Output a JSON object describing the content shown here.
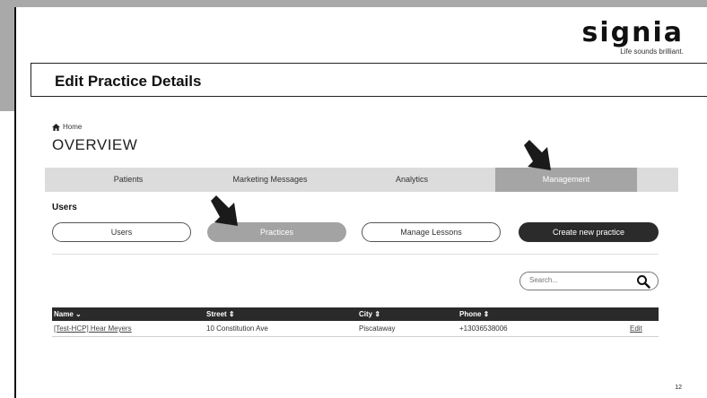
{
  "logo": {
    "wordmark": "signia",
    "tagline": "Life sounds brilliant."
  },
  "slide": {
    "title": "Edit Practice Details",
    "page_number": "12"
  },
  "breadcrumb": {
    "home_label": "Home"
  },
  "page": {
    "heading": "OVERVIEW"
  },
  "nav": {
    "tabs": [
      {
        "label": "Patients"
      },
      {
        "label": "Marketing Messages"
      },
      {
        "label": "Analytics"
      },
      {
        "label": "Management",
        "active": true
      }
    ]
  },
  "users_section": {
    "label": "Users",
    "buttons": {
      "users": "Users",
      "practices": "Practices",
      "manage_lessons": "Manage Lessons",
      "create_practice": "Create new practice"
    }
  },
  "search": {
    "placeholder": "Search..."
  },
  "table": {
    "headers": [
      "Name ⌄",
      "Street ⇕",
      "City ⇕",
      "Phone ⇕",
      ""
    ],
    "rows": [
      {
        "name": "[Test-HCP] Hear Meyers",
        "street": "10 Constitution Ave",
        "city": "Piscataway",
        "phone": "+13036538006",
        "action": "Edit"
      }
    ]
  },
  "colors": {
    "header_dark": "#2a2a2a",
    "active_tab": "#a5a5a5",
    "nav_bg": "#dcdcdc",
    "primary_button": "#2b2b2b"
  }
}
